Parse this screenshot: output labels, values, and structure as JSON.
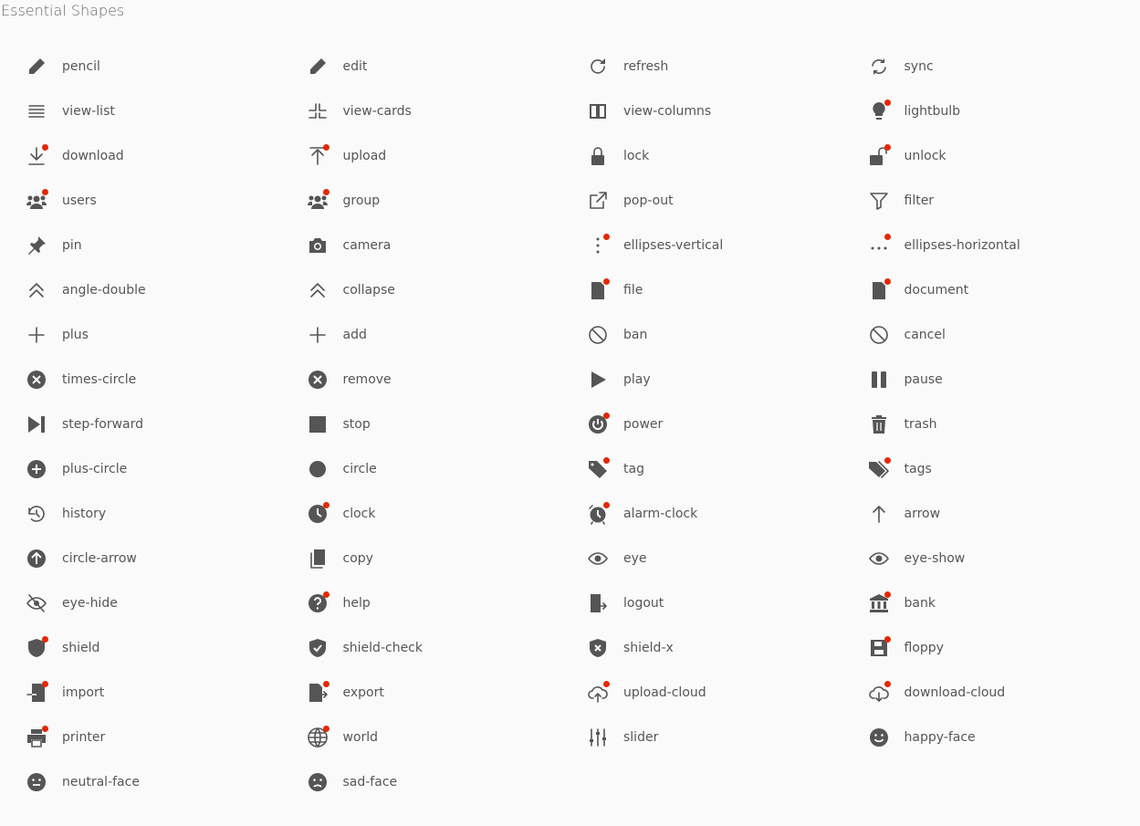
{
  "title": "Essential Shapes",
  "colors": {
    "icon": "#555555",
    "badge": "#e62700",
    "background": "#fafafa"
  },
  "items": [
    {
      "label": "pencil",
      "icon": "pencil",
      "badge": false
    },
    {
      "label": "edit",
      "icon": "pencil",
      "badge": false
    },
    {
      "label": "refresh",
      "icon": "refresh",
      "badge": false
    },
    {
      "label": "sync",
      "icon": "sync",
      "badge": false
    },
    {
      "label": "view-list",
      "icon": "view-list",
      "badge": false
    },
    {
      "label": "view-cards",
      "icon": "view-cards",
      "badge": false
    },
    {
      "label": "view-columns",
      "icon": "view-columns",
      "badge": false
    },
    {
      "label": "lightbulb",
      "icon": "lightbulb",
      "badge": true
    },
    {
      "label": "download",
      "icon": "download",
      "badge": true
    },
    {
      "label": "upload",
      "icon": "upload",
      "badge": true
    },
    {
      "label": "lock",
      "icon": "lock",
      "badge": false
    },
    {
      "label": "unlock",
      "icon": "unlock",
      "badge": true
    },
    {
      "label": "users",
      "icon": "users",
      "badge": true
    },
    {
      "label": "group",
      "icon": "users",
      "badge": true
    },
    {
      "label": "pop-out",
      "icon": "pop-out",
      "badge": false
    },
    {
      "label": "filter",
      "icon": "filter",
      "badge": false
    },
    {
      "label": "pin",
      "icon": "pin",
      "badge": false
    },
    {
      "label": "camera",
      "icon": "camera",
      "badge": false
    },
    {
      "label": "ellipses-vertical",
      "icon": "ellipses-vertical",
      "badge": true
    },
    {
      "label": "ellipses-horizontal",
      "icon": "ellipses-horizontal",
      "badge": true
    },
    {
      "label": "angle-double",
      "icon": "angle-double",
      "badge": false
    },
    {
      "label": "collapse",
      "icon": "angle-double",
      "badge": false
    },
    {
      "label": "file",
      "icon": "file",
      "badge": true
    },
    {
      "label": "document",
      "icon": "file",
      "badge": true
    },
    {
      "label": "plus",
      "icon": "plus",
      "badge": false
    },
    {
      "label": "add",
      "icon": "plus",
      "badge": false
    },
    {
      "label": "ban",
      "icon": "ban",
      "badge": false
    },
    {
      "label": "cancel",
      "icon": "ban",
      "badge": false
    },
    {
      "label": "times-circle",
      "icon": "times-circle",
      "badge": false
    },
    {
      "label": "remove",
      "icon": "times-circle",
      "badge": false
    },
    {
      "label": "play",
      "icon": "play",
      "badge": false
    },
    {
      "label": "pause",
      "icon": "pause",
      "badge": false
    },
    {
      "label": "step-forward",
      "icon": "step-forward",
      "badge": false
    },
    {
      "label": "stop",
      "icon": "stop",
      "badge": false
    },
    {
      "label": "power",
      "icon": "power",
      "badge": true
    },
    {
      "label": "trash",
      "icon": "trash",
      "badge": false
    },
    {
      "label": "plus-circle",
      "icon": "plus-circle",
      "badge": false
    },
    {
      "label": "circle",
      "icon": "circle",
      "badge": false
    },
    {
      "label": "tag",
      "icon": "tag",
      "badge": true
    },
    {
      "label": "tags",
      "icon": "tags",
      "badge": true
    },
    {
      "label": "history",
      "icon": "history",
      "badge": false
    },
    {
      "label": "clock",
      "icon": "clock",
      "badge": true
    },
    {
      "label": "alarm-clock",
      "icon": "alarm-clock",
      "badge": true
    },
    {
      "label": "arrow",
      "icon": "arrow",
      "badge": false
    },
    {
      "label": "circle-arrow",
      "icon": "circle-arrow",
      "badge": false
    },
    {
      "label": "copy",
      "icon": "copy",
      "badge": false
    },
    {
      "label": "eye",
      "icon": "eye",
      "badge": false
    },
    {
      "label": "eye-show",
      "icon": "eye",
      "badge": false
    },
    {
      "label": "eye-hide",
      "icon": "eye-hide",
      "badge": false
    },
    {
      "label": "help",
      "icon": "help",
      "badge": true
    },
    {
      "label": "logout",
      "icon": "logout",
      "badge": false
    },
    {
      "label": "bank",
      "icon": "bank",
      "badge": true
    },
    {
      "label": "shield",
      "icon": "shield",
      "badge": true
    },
    {
      "label": "shield-check",
      "icon": "shield-check",
      "badge": false
    },
    {
      "label": "shield-x",
      "icon": "shield-x",
      "badge": false
    },
    {
      "label": "floppy",
      "icon": "floppy",
      "badge": true
    },
    {
      "label": "import",
      "icon": "import",
      "badge": true
    },
    {
      "label": "export",
      "icon": "export",
      "badge": true
    },
    {
      "label": "upload-cloud",
      "icon": "upload-cloud",
      "badge": true
    },
    {
      "label": "download-cloud",
      "icon": "download-cloud",
      "badge": true
    },
    {
      "label": "printer",
      "icon": "printer",
      "badge": true
    },
    {
      "label": "world",
      "icon": "world",
      "badge": true
    },
    {
      "label": "slider",
      "icon": "slider",
      "badge": false
    },
    {
      "label": "happy-face",
      "icon": "happy-face",
      "badge": false
    },
    {
      "label": "neutral-face",
      "icon": "neutral-face",
      "badge": false
    },
    {
      "label": "sad-face",
      "icon": "sad-face",
      "badge": false
    }
  ]
}
